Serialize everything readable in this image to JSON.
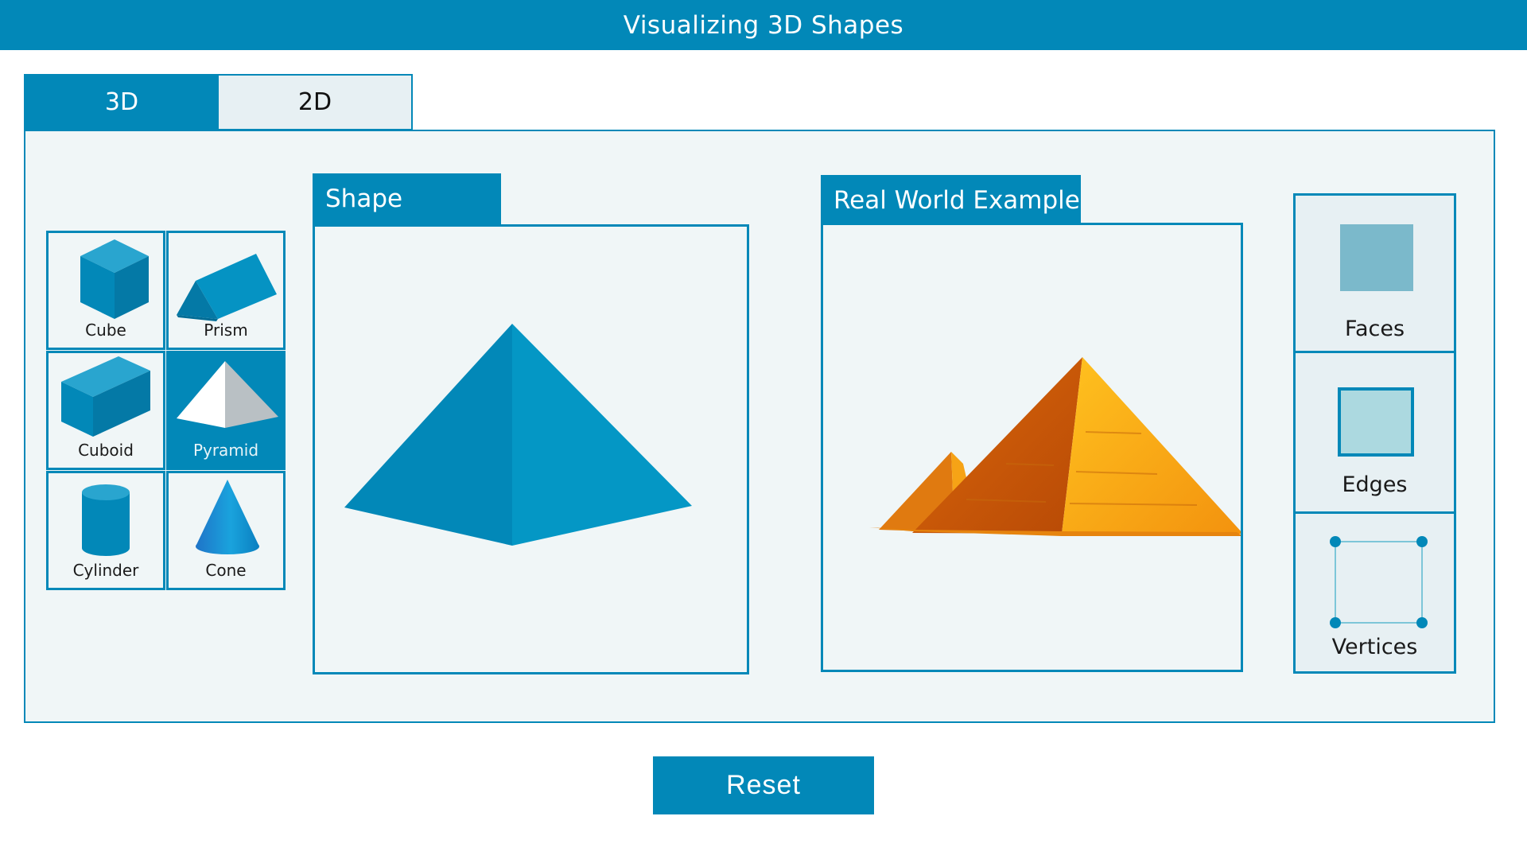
{
  "app": {
    "title": "Visualizing 3D Shapes"
  },
  "tabs": [
    {
      "label": "3D",
      "active": true
    },
    {
      "label": "2D",
      "active": false
    }
  ],
  "shape_grid": {
    "selected": "Pyramid",
    "items": [
      {
        "label": "Cube",
        "icon": "cube-icon"
      },
      {
        "label": "Prism",
        "icon": "prism-icon"
      },
      {
        "label": "Cuboid",
        "icon": "cuboid-icon"
      },
      {
        "label": "Pyramid",
        "icon": "pyramid-icon"
      },
      {
        "label": "Cylinder",
        "icon": "cylinder-icon"
      },
      {
        "label": "Cone",
        "icon": "cone-icon"
      }
    ]
  },
  "shape_view": {
    "header": "Shape",
    "icon": "pyramid-3d-icon"
  },
  "real_world": {
    "header": "Real World Example",
    "icon": "egyptian-pyramids-icon"
  },
  "properties": [
    {
      "label": "Faces",
      "icon": "face-square-icon"
    },
    {
      "label": "Edges",
      "icon": "edge-square-icon"
    },
    {
      "label": "Vertices",
      "icon": "vertices-square-icon"
    }
  ],
  "reset_label": "Reset",
  "colors": {
    "primary": "#0288b8",
    "panel_bg": "#f0f6f7",
    "tab_inactive_bg": "#e7f0f3"
  }
}
